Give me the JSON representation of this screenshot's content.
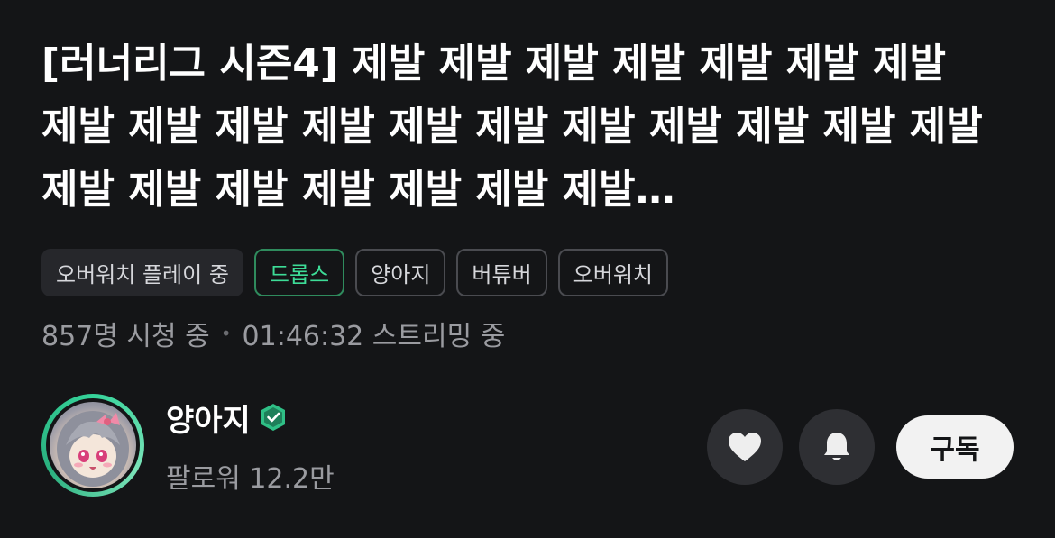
{
  "stream": {
    "title": "[러너리그 시즌4] 제발 제발 제발 제발 제발 제발 제발 제발 제발 제발 제발 제발 제발 제발 제발 제발 제발 제발 제발 제발 제발 제발 제발 제발 제발…",
    "tags": [
      {
        "label": "오버워치 플레이 중",
        "kind": "category"
      },
      {
        "label": "드롭스",
        "kind": "accent"
      },
      {
        "label": "양아지",
        "kind": "outline"
      },
      {
        "label": "버튜버",
        "kind": "outline"
      },
      {
        "label": "오버워치",
        "kind": "outline"
      }
    ],
    "viewers": "857명 시청 중",
    "separator": "•",
    "duration": "01:46:32 스트리밍 중"
  },
  "channel": {
    "name": "양아지",
    "followers": "팔로워 12.2만",
    "verified_icon": "verified-badge-icon",
    "ring_color": "#35d39a"
  },
  "actions": {
    "like_icon": "heart-icon",
    "notify_icon": "bell-icon",
    "subscribe_label": "구독"
  },
  "colors": {
    "background": "#141517",
    "accent": "#3ddc97",
    "muted_text": "#9a9ba0"
  }
}
